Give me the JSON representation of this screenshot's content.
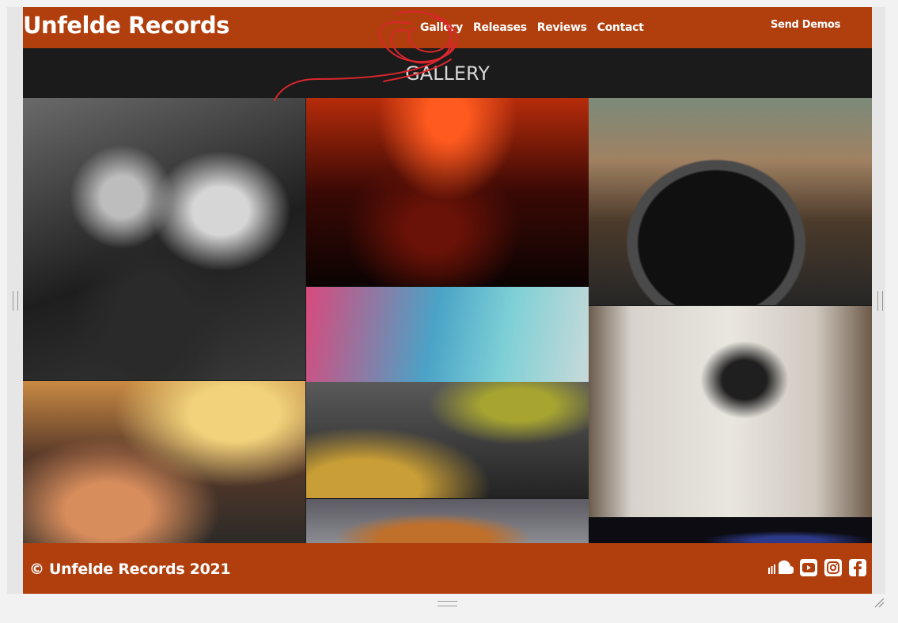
{
  "header": {
    "brand": "Unfelde Records",
    "nav": [
      {
        "label": "Gallery"
      },
      {
        "label": "Releases"
      },
      {
        "label": "Reviews"
      },
      {
        "label": "Contact"
      }
    ],
    "send_demos": "Send Demos"
  },
  "main": {
    "title": "GALLERY",
    "photos": [
      "dj-booth-bw",
      "dj-red-lights",
      "turntable-terrace",
      "festival-crowd",
      "festival-tent-decks",
      "autumn-tree",
      "record-studio",
      "concert-blue"
    ]
  },
  "footer": {
    "copyright": "© Unfelde Records 2021",
    "social_icons": [
      "soundcloud-icon",
      "youtube-icon",
      "instagram-icon",
      "facebook-icon"
    ]
  },
  "colors": {
    "brand": "#b13f0e",
    "page_bg": "#1b1b1b",
    "annotation": "#d9262c"
  }
}
